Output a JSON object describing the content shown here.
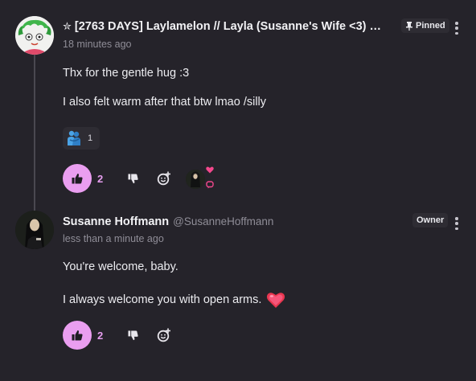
{
  "comments": [
    {
      "author": "[2763 DAYS] Laylamelon // Layla (Susanne's Wife <3) …",
      "star_glyph": "✮",
      "timestamp": "18 minutes ago",
      "badge": "Pinned",
      "paragraphs": [
        "Thx for the gentle hug :3",
        "I also felt warm after that btw lmao /silly"
      ],
      "reactions": [
        {
          "icon": "hugging-people-icon",
          "count": "1"
        }
      ],
      "like_count": "2",
      "colors": {
        "like": "#ea9ef0"
      }
    },
    {
      "author": "Susanne Hoffmann",
      "handle": "@SusanneHoffmann",
      "timestamp": "less than a minute ago",
      "badge": "Owner",
      "paragraphs": [
        "You're welcome, baby.",
        "I always welcome you with open arms."
      ],
      "like_count": "2"
    }
  ]
}
